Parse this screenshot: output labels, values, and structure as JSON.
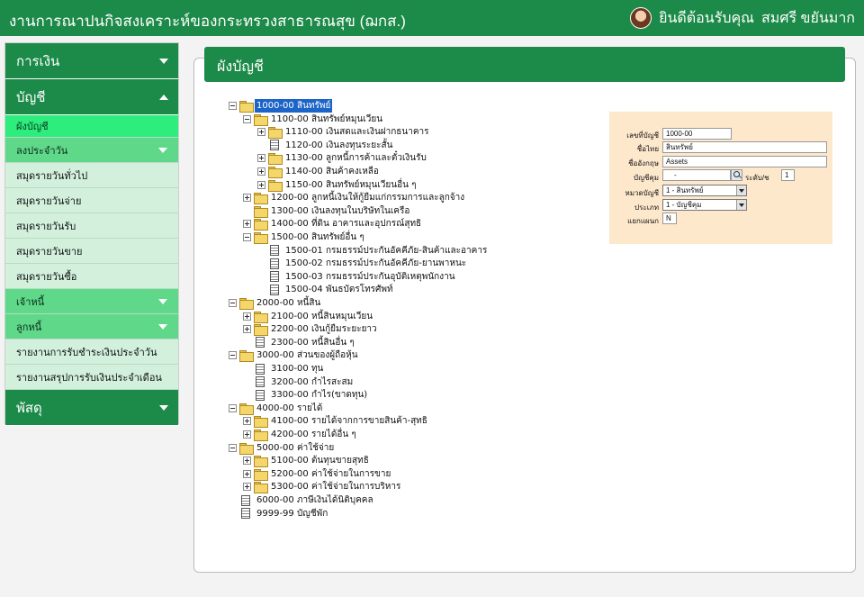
{
  "app": {
    "title": "งานการณาปนกิจสงเคราะห์ของกระทรวงสาธารณสุข (ฌกส.)",
    "welcome": "ยินดีต้อนรับคุณ",
    "user_name": "สมศรี ขยันมาก"
  },
  "sidebar": {
    "finance": "การเงิน",
    "accounts": "บัญชี",
    "chart_of_accounts": "ผังบัญชี",
    "daily_post": "ลงประจำวัน",
    "general_journal": "สมุดรายวันทั่วไป",
    "payment_journal": "สมุดรายวันจ่าย",
    "receipt_journal": "สมุดรายวันรับ",
    "sales_journal": "สมุดรายวันขาย",
    "purchase_journal": "สมุดรายวันซื้อ",
    "creditors": "เจ้าหนี้",
    "debtors": "ลูกหนี้",
    "daily_receipt_report": "รายงานการรับชำระเงินประจำวัน",
    "monthly_receipt_summary": "รายงานสรุปการรับเงินประจำเดือน",
    "supplies": "พัสดุ"
  },
  "main": {
    "header": "ผังบัญชี"
  },
  "tree": [
    {
      "label": "1000-00 สินทรัพย์"
    },
    {
      "label": "1100-00 สินทรัพย์หมุนเวียน"
    },
    {
      "label": "1110-00 เงินสดและเงินฝากธนาคาร"
    },
    {
      "label": "1120-00 เงินลงทุนระยะสั้น"
    },
    {
      "label": "1130-00 ลูกหนี้การค้าและตั๋วเงินรับ"
    },
    {
      "label": "1140-00 สินค้าคงเหลือ"
    },
    {
      "label": "1150-00 สินทรัพย์หมุนเวียนอื่น ๆ"
    },
    {
      "label": "1200-00 ลูกหนี้เงินให้กู้ยืมแก่กรรมการและลูกจ้าง"
    },
    {
      "label": "1300-00 เงินลงทุนในบริษัทในเครือ"
    },
    {
      "label": "1400-00 ที่ดิน อาคารและอุปกรณ์สุทธิ"
    },
    {
      "label": "1500-00 สินทรัพย์อื่น ๆ"
    },
    {
      "label": "1500-01 กรมธรรม์ประกันอัคคีภัย-สินค้าและอาคาร"
    },
    {
      "label": "1500-02 กรมธรรม์ประกันอัคคีภัย-ยานพาหนะ"
    },
    {
      "label": "1500-03 กรมธรรม์ประกันอุบัติเหตุพนักงาน"
    },
    {
      "label": "1500-04 พันธบัตรโทรศัพท์"
    },
    {
      "label": "2000-00 หนี้สิน"
    },
    {
      "label": "2100-00 หนี้สินหมุนเวียน"
    },
    {
      "label": "2200-00 เงินกู้ยืมระยะยาว"
    },
    {
      "label": "2300-00 หนี้สินอื่น ๆ"
    },
    {
      "label": "3000-00 ส่วนของผู้ถือหุ้น"
    },
    {
      "label": "3100-00 ทุน"
    },
    {
      "label": "3200-00 กำไรสะสม"
    },
    {
      "label": "3300-00 กำไร(ขาดทุน)"
    },
    {
      "label": "4000-00 รายได้"
    },
    {
      "label": "4100-00 รายได้จากการขายสินค้า-สุทธิ"
    },
    {
      "label": "4200-00 รายได้อื่น ๆ"
    },
    {
      "label": "5000-00 ค่าใช้จ่าย"
    },
    {
      "label": "5100-00 ต้นทุนขายสุทธิ"
    },
    {
      "label": "5200-00 ค่าใช้จ่ายในการขาย"
    },
    {
      "label": "5300-00 ค่าใช้จ่ายในการบริหาร"
    },
    {
      "label": "6000-00 ภาษีเงินได้นิติบุคคล"
    },
    {
      "label": "9999-99 บัญชีพัก"
    }
  ],
  "form": {
    "account_no_label": "เลขที่บัญชี",
    "account_no": "1000-00",
    "thai_name_label": "ชื่อไทย",
    "thai_name": "สินทรัพย์",
    "english_name_label": "ชื่ออังกฤษ",
    "english_name": "Assets",
    "control_account_label": "บัญชีคุม",
    "control_account": "-",
    "level_label": "ระดับ/ช",
    "level": "1",
    "category_label": "หมวดบัญชี",
    "category": "1 - สินทรัพย์",
    "type_label": "ประเภท",
    "type": "1 - บัญชีคุม",
    "department_label": "แยกแผนก",
    "department": "N"
  }
}
